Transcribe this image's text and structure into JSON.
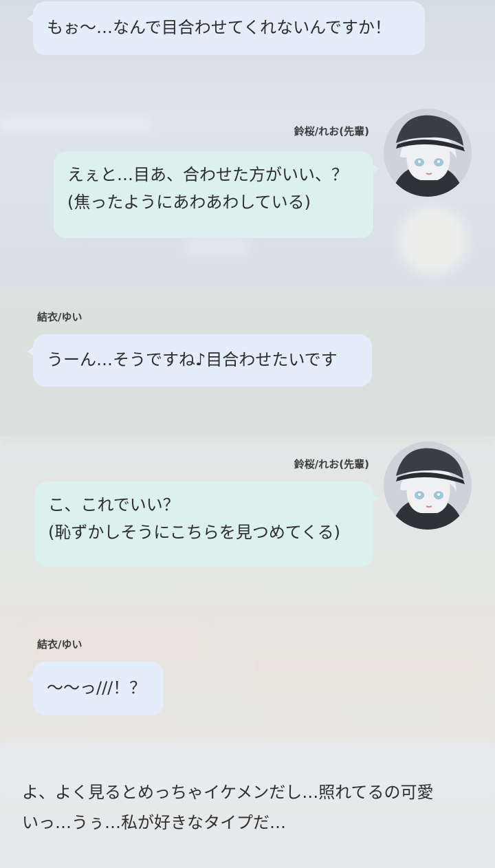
{
  "messages": [
    {
      "sender": "",
      "text": "もぉ〜…なんで目合わせてくれないんですか！"
    },
    {
      "sender": "鈴桜/れお(先輩)",
      "text": "えぇと…目あ、合わせた方がいい、？\n(焦ったようにあわあわしている)"
    },
    {
      "sender": "結衣/ゆい",
      "text": "うーん…そうですね♪目合わせたいです"
    },
    {
      "sender": "鈴桜/れお(先輩)",
      "text": "こ、これでいい？\n(恥ずかしそうにこちらを見つめてくる)"
    },
    {
      "sender": "結衣/ゆい",
      "text": "〜〜っ///！？"
    }
  ],
  "narration": "よ、よく見るとめっちゃイケメンだし…照れてるの可愛\nいっ…うぅ…私が好きなタイプだ…",
  "avatar_icon": "anime-boy-white-hair-black-cap-icon",
  "colors": {
    "left_bubble": "#e3eefa",
    "right_bubble": "#dcf0ee",
    "name_text": "#3c3c3c"
  }
}
